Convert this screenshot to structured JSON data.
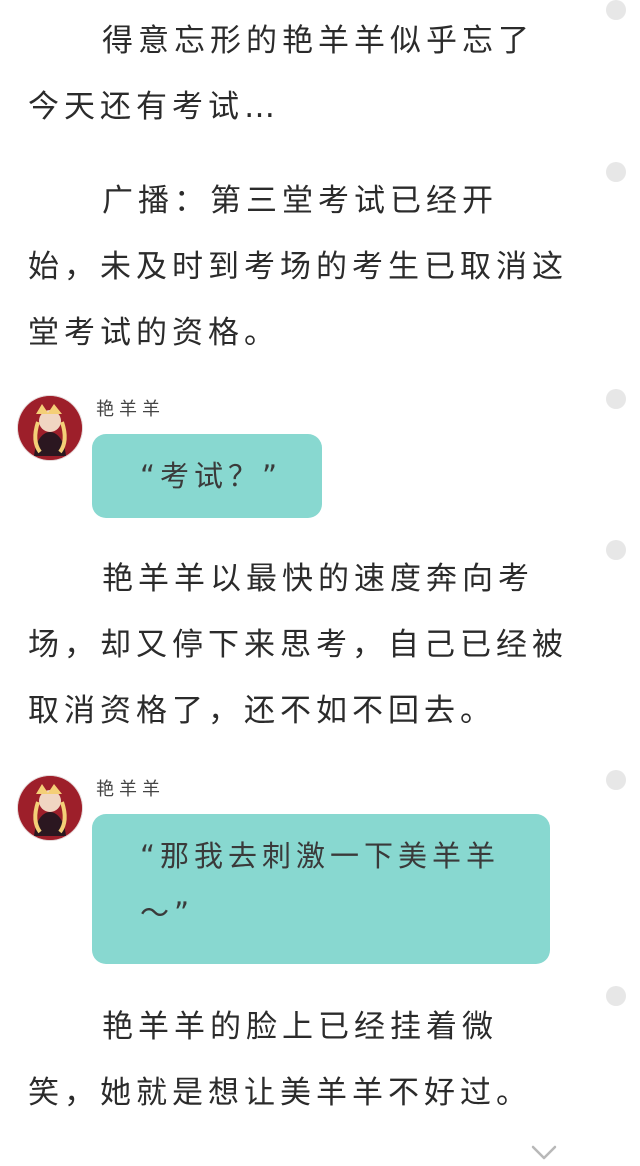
{
  "content": {
    "paragraphs": [
      "得意忘形的艳羊羊似乎忘了今天还有考试…",
      "广播：第三堂考试已经开始，未及时到考场的考生已取消这堂考试的资格。",
      "艳羊羊以最快的速度奔向考场，却又停下来思考，自己已经被取消资格了，还不如不回去。",
      "艳羊羊的脸上已经挂着微笑，她就是想让美羊羊不好过。"
    ],
    "dialogues": [
      {
        "speaker": "艳羊羊",
        "text": "“考试？”"
      },
      {
        "speaker": "艳羊羊",
        "text": "“那我去刺激一下美羊羊～”"
      }
    ]
  },
  "icons": {
    "comment_dot": "dot-icon",
    "avatar": "avatar-icon",
    "chevron": "chevron-down-icon"
  },
  "colors": {
    "bubble": "#88d8d0",
    "dot": "#e7e7e7",
    "text": "#2b2b2b"
  }
}
